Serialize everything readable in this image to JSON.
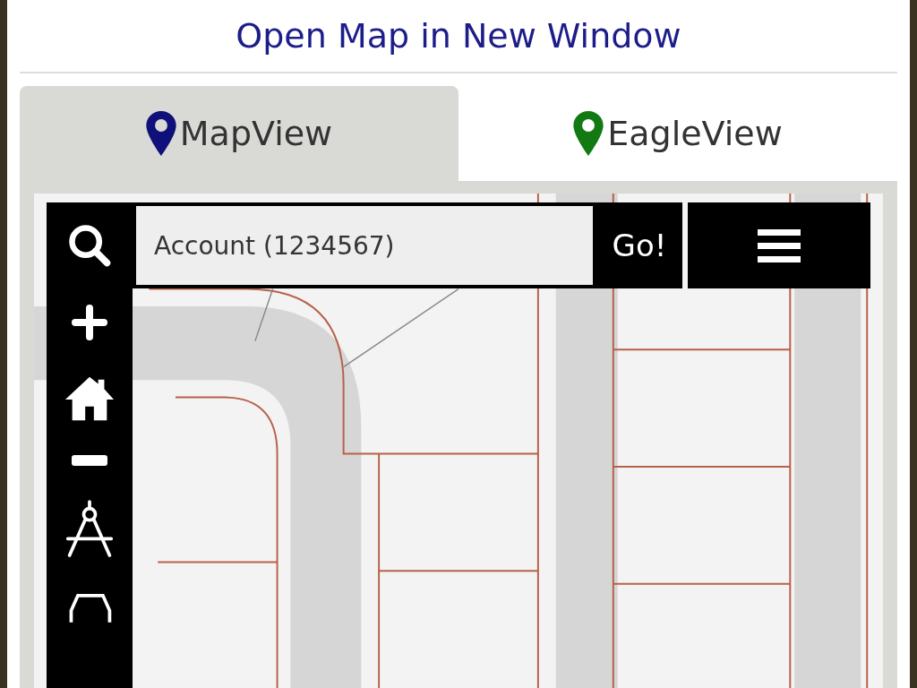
{
  "header": {
    "link": "Open Map in New Window"
  },
  "tabs": [
    {
      "label": "MapView",
      "selected": true,
      "color": "#10107a"
    },
    {
      "label": "EagleView",
      "selected": false,
      "color": "#137a13"
    }
  ],
  "map_toolbar": {
    "search": {
      "placeholder": "Account (1234567)"
    },
    "go_button": "Go!"
  }
}
